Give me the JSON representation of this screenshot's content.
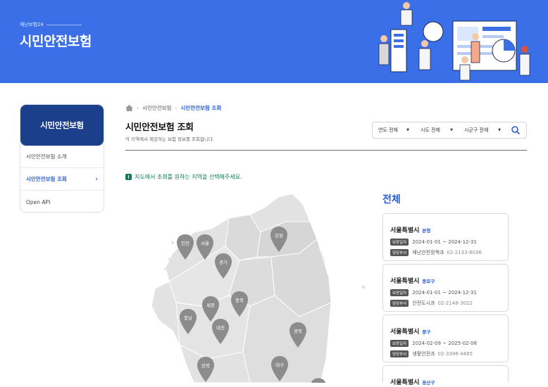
{
  "hero": {
    "subtitle": "재난보험24",
    "title": "시민안전보험"
  },
  "sidebar": {
    "title": "시민안전보험",
    "items": [
      {
        "label": "시민안전보험 소개",
        "active": false
      },
      {
        "label": "시민안전보험 조회",
        "active": true
      },
      {
        "label": "Open API",
        "active": false
      }
    ]
  },
  "breadcrumb": {
    "home": "home-icon",
    "level1": "시민안전보험",
    "level2": "시민안전보험 조회"
  },
  "page": {
    "title": "시민안전보험 조회",
    "description": "각 지역에서 제공하는 보험 정보를 조회합니다."
  },
  "filters": {
    "year": "연도 전체",
    "sido": "시도 전체",
    "sigungu": "시군구 전체"
  },
  "notice": "지도에서 조회를 원하는 지역을 선택해주세요.",
  "map": {
    "pins": [
      "인천",
      "서울",
      "강원",
      "경기",
      "세종",
      "충북",
      "충남",
      "대전",
      "경북",
      "대구",
      "전북"
    ]
  },
  "list": {
    "title": "전체",
    "cards": [
      {
        "city": "서울특별시",
        "district": "본청",
        "period_label": "보장일자",
        "period": "2024-01-01 ~ 2024-12-31",
        "dept_label": "담당부서",
        "dept": "재난안전정책과",
        "tel": "02-2133-8036"
      },
      {
        "city": "서울특별시",
        "district": "종로구",
        "period_label": "보장일자",
        "period": "2024-01-01 ~ 2024-12-31",
        "dept_label": "담당부서",
        "dept": "안전도시과",
        "tel": "02-2148-3022"
      },
      {
        "city": "서울특별시",
        "district": "중구",
        "period_label": "보장일자",
        "period": "2024-02-09 ~ 2025-02-08",
        "dept_label": "담당부서",
        "dept": "생활안전과",
        "tel": "02-3396-4485"
      },
      {
        "city": "서울특별시",
        "district": "용산구"
      }
    ]
  }
}
